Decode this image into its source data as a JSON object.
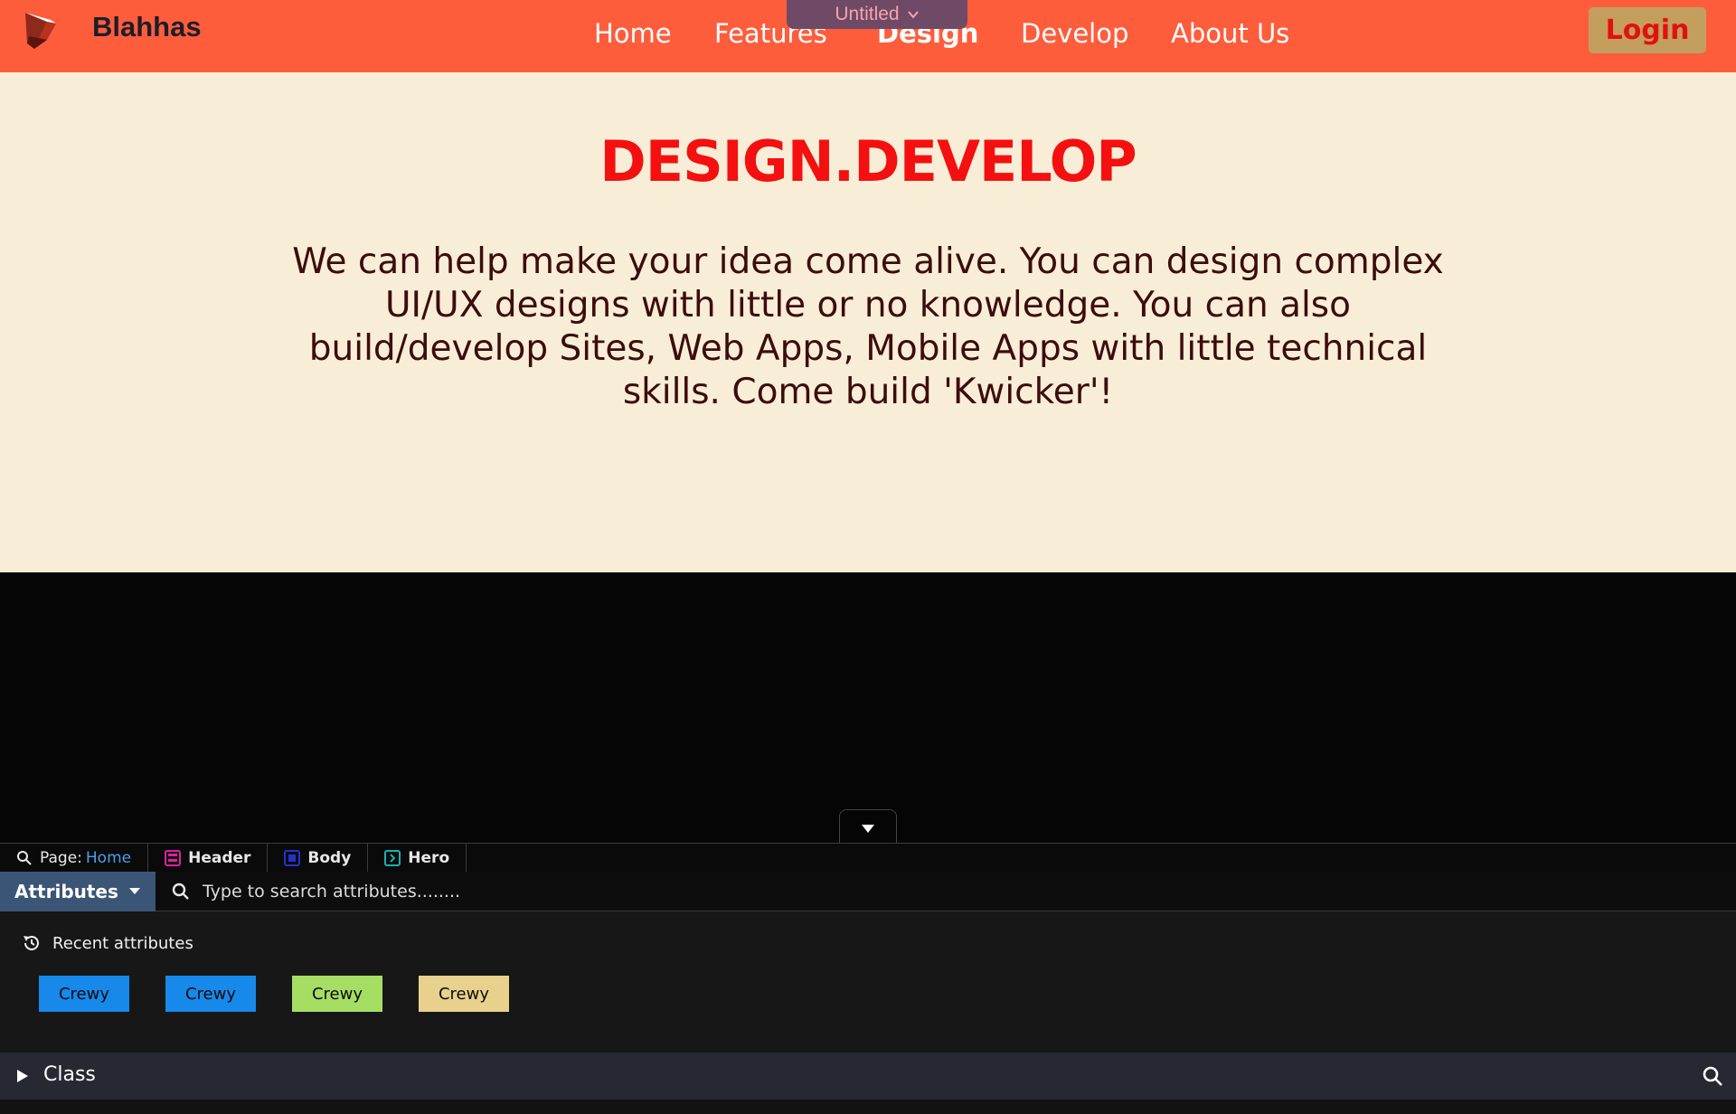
{
  "header": {
    "brand": "Blahhas",
    "nav": [
      {
        "label": "Home",
        "active": false
      },
      {
        "label": "Features",
        "active": false
      },
      {
        "label": "Design",
        "active": true
      },
      {
        "label": "Develop",
        "active": false
      },
      {
        "label": "About Us",
        "active": false
      }
    ],
    "login_label": "Login",
    "page_selector": "Untitled"
  },
  "hero": {
    "title": "DESIGN.DEVELOP",
    "text": "We can help make your idea come alive. You can design complex UI/UX designs with little or no knowledge. You can also build/develop Sites, Web Apps, Mobile Apps with little technical skills. Come build 'Kwicker'!"
  },
  "editor": {
    "breadcrumb": {
      "page_label": "Page:",
      "page_value": "Home",
      "items": [
        "Header",
        "Body",
        "Hero"
      ]
    },
    "attributes": {
      "dropdown_label": "Attributes",
      "search_placeholder": "Type to search attributes........",
      "recent_label": "Recent attributes",
      "chips": [
        {
          "label": "Crewy",
          "color": "#1689ea"
        },
        {
          "label": "Crewy",
          "color": "#1689ea"
        },
        {
          "label": "Crewy",
          "color": "#a6de63"
        },
        {
          "label": "Crewy",
          "color": "#e8d18c"
        }
      ]
    },
    "class_section": {
      "label": "Class"
    }
  },
  "colors": {
    "header_bg": "#fe5d3c",
    "hero_bg": "#f8eed7",
    "hero_title": "#f41010",
    "login_bg": "#c49e5d"
  }
}
